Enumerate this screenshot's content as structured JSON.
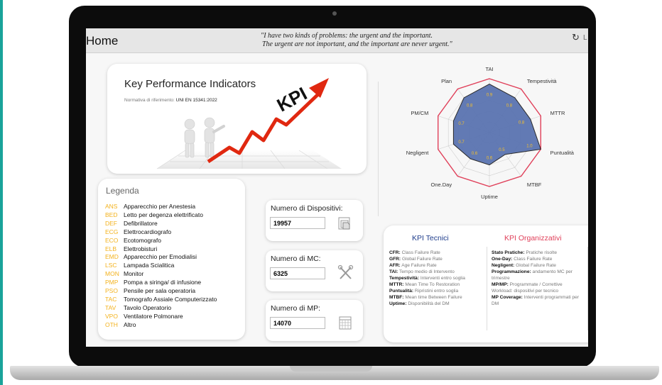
{
  "screen": {
    "title": "Home",
    "quote_line1": "\"I have two kinds of problems: the urgent and the important.",
    "quote_line2": "The urgent are not important, and the important are never urgent.\"",
    "refresh_label": "L"
  },
  "kpi_card": {
    "title": "Key Performance Indicators",
    "norm_label": "Normativa di riferimento:",
    "norm_value": "UNI EN 15341:2022",
    "banner_text": "KPI"
  },
  "legend": {
    "title": "Legenda",
    "items": [
      {
        "code": "ANS",
        "label": "Apparecchio per Anestesia"
      },
      {
        "code": "BED",
        "label": "Letto per degenza elettrificato"
      },
      {
        "code": "DEF",
        "label": "Defibrillatore"
      },
      {
        "code": "ECG",
        "label": "Elettrocardiografo"
      },
      {
        "code": "ECO",
        "label": "Ecotomografo"
      },
      {
        "code": "ELB",
        "label": "Elettrobisturi"
      },
      {
        "code": "EMD",
        "label": "Apparecchio per Emodialisi"
      },
      {
        "code": "LSC",
        "label": "Lampada Scialitica"
      },
      {
        "code": "MON",
        "label": "Monitor"
      },
      {
        "code": "PMP",
        "label": "Pompa a siringa/ di infusione"
      },
      {
        "code": "PSO",
        "label": "Pensile per sala operatoria"
      },
      {
        "code": "TAC",
        "label": "Tomografo Assiale Computerizzato"
      },
      {
        "code": "TAV",
        "label": "Tavolo Operatorio"
      },
      {
        "code": "VPO",
        "label": "Ventilatore Polmonare"
      },
      {
        "code": "OTH",
        "label": "Altro"
      }
    ]
  },
  "stats": {
    "devices": {
      "label": "Numero di Dispositivi:",
      "value": "19957",
      "icon": "open-folder-icon"
    },
    "mc": {
      "label": "Numero di MC:",
      "value": "6325",
      "icon": "tools-icon"
    },
    "mp": {
      "label": "Numero di MP:",
      "value": "14070",
      "icon": "calendar-icon"
    }
  },
  "chart_data": {
    "type": "radar",
    "axes": [
      "TAI",
      "Tempestività",
      "MTTR",
      "Puntualità",
      "MTBF",
      "Uptime",
      "One.Day",
      "Negligent",
      "PM/CM",
      "Plan"
    ],
    "values": [
      0.9,
      0.8,
      0.8,
      1.0,
      0.5,
      0.6,
      0.6,
      0.7,
      0.7,
      0.8
    ],
    "value_labels": [
      "0.9",
      "0.8",
      "0.8",
      "1.0",
      "0.5",
      "0.6",
      "0.6",
      "0.7",
      "0.7",
      "0.8"
    ],
    "threshold": 1.0,
    "fill_color": "#5a73b0",
    "threshold_color": "#e0405a"
  },
  "kpi_info": {
    "tecnici_title": "KPI Tecnici",
    "tecnici_color": "#1f3d8c",
    "tecnici": [
      {
        "abbr": "CFR:",
        "desc": "Class Failure Rate"
      },
      {
        "abbr": "GFR:",
        "desc": "Global Failure Rate"
      },
      {
        "abbr": "AFR:",
        "desc": "Age Failure Rate"
      },
      {
        "abbr": "TAI:",
        "desc": "Tempo medio di Intervento"
      },
      {
        "abbr": "Tempestività:",
        "desc": "Interventi entro soglia"
      },
      {
        "abbr": "MTTR:",
        "desc": "Mean Time To Restoration"
      },
      {
        "abbr": "Puntualità:",
        "desc": "Ripristini entro soglia"
      },
      {
        "abbr": "MTBF:",
        "desc": "Mean time Between Failure"
      },
      {
        "abbr": "Uptime:",
        "desc": "Disponibilità del DM"
      }
    ],
    "organizzativi_title": "KPI Organizzativi",
    "organizzativi_color": "#e0405a",
    "organizzativi": [
      {
        "abbr": "Stato Pratiche:",
        "desc": "Pratiche risolte"
      },
      {
        "abbr": "One-Day:",
        "desc": "Class Failure Rate"
      },
      {
        "abbr": "Negligent:",
        "desc": "Global Failure Rate"
      },
      {
        "abbr": "Programmazione:",
        "desc": "andamento MC per trimestre"
      },
      {
        "abbr": "MP/MP:",
        "desc": "Programmate / Correttive"
      },
      {
        "abbr": "",
        "desc": "Workload: dispositivi per tecnico"
      },
      {
        "abbr": "MP Coverage:",
        "desc": "Interventi programmati per DM"
      }
    ]
  }
}
